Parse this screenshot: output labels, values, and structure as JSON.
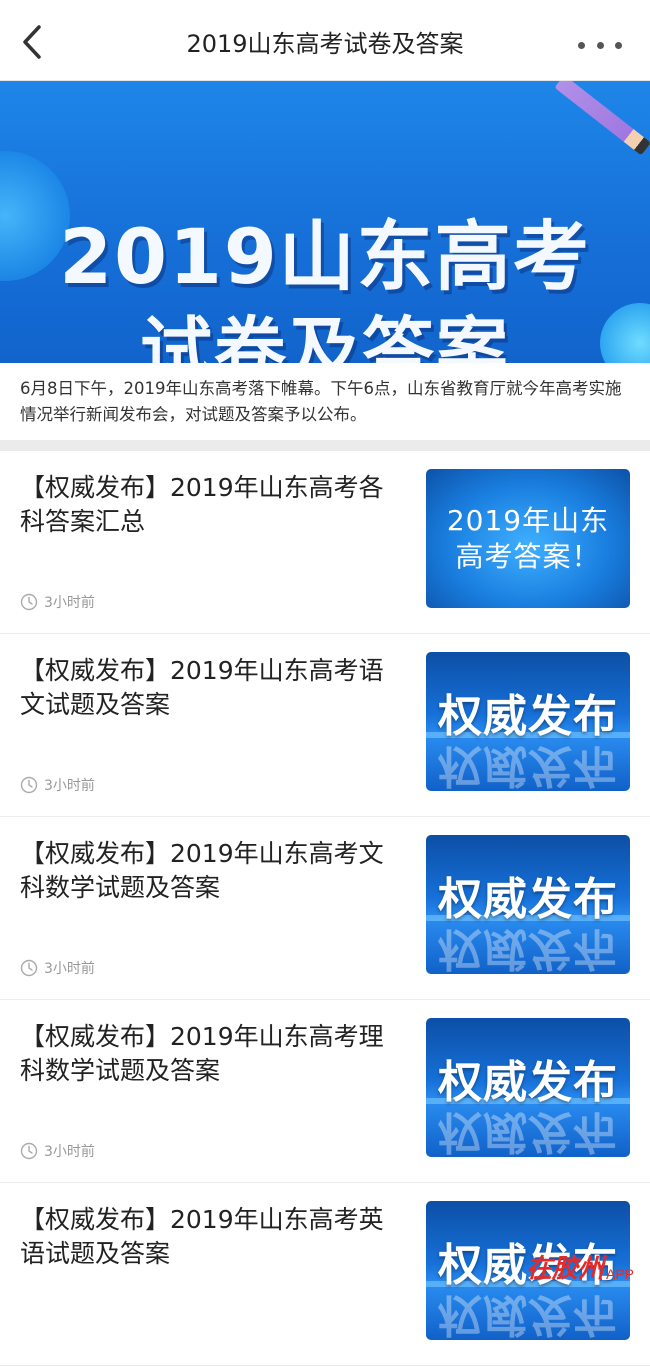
{
  "nav": {
    "title": "2019山东高考试卷及答案",
    "back_icon": "chevron-left-icon",
    "more_icon": "more-dots-icon"
  },
  "banner": {
    "line1": "2019山东高考",
    "line2": "试卷及答案"
  },
  "intro": "6月8日下午，2019年山东高考落下帷幕。下午6点，山东省教育厅就今年高考实施情况举行新闻发布会，对试题及答案予以公布。",
  "articles": [
    {
      "title": "【权威发布】2019年山东高考各科答案汇总",
      "time": "3小时前",
      "thumb_lines": [
        "2019年山东",
        "高考答案！"
      ]
    },
    {
      "title": "【权威发布】2019年山东高考语文试题及答案",
      "time": "3小时前",
      "thumb_text": "权威发布"
    },
    {
      "title": "【权威发布】2019年山东高考文科数学试题及答案",
      "time": "3小时前",
      "thumb_text": "权威发布"
    },
    {
      "title": "【权威发布】2019年山东高考理科数学试题及答案",
      "time": "3小时前",
      "thumb_text": "权威发布"
    },
    {
      "title": "【权威发布】2019年山东高考英语试题及答案",
      "time": "",
      "thumb_text": "权威发布"
    }
  ],
  "watermark": {
    "main": "在胶州",
    "suffix": "APP"
  },
  "colors": {
    "banner_blue": "#1670d8",
    "watermark_red": "#e52a2a"
  }
}
